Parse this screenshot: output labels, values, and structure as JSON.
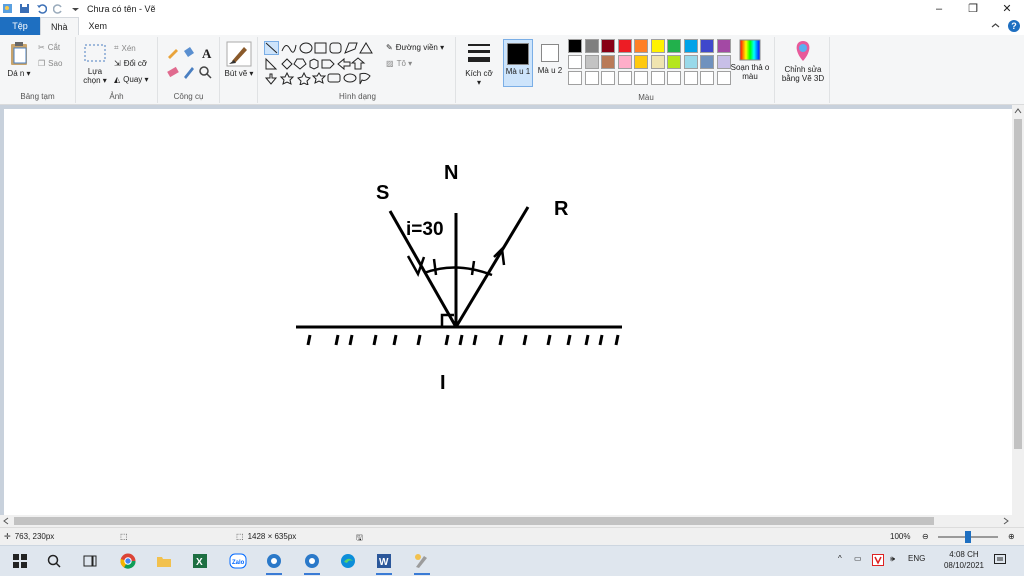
{
  "titlebar": {
    "title": "Chưa có tên - Vẽ",
    "minimize": "–",
    "restore": "❐",
    "close": "✕"
  },
  "tabs": [
    "Tệp",
    "Nhà",
    "Xem"
  ],
  "ribbon": {
    "clipboard": {
      "paste": "Dá n ▾",
      "cut": "Cắt",
      "copy": "Sao",
      "label": "Bảng tạm"
    },
    "image": {
      "select": "Lựa chọn ▾",
      "crop": "Xén",
      "resize": "Đổi cỡ",
      "rotate": "Quay ▾",
      "label": "Ảnh"
    },
    "tools": {
      "label": "Công cụ"
    },
    "brushes": {
      "label": "Bút vẽ ▾"
    },
    "shapes": {
      "outline": "Đường viền ▾",
      "fill": "Tô ▾",
      "label": "Hình dạng"
    },
    "size": {
      "label": "Kích cỡ ▾"
    },
    "color1": "Mà u 1",
    "color2": "Mà u 2",
    "colors_label": "Màu",
    "edit_colors": "Soạn thả o màu",
    "paint3d": "Chỉnh sửa bằng Vẽ 3D",
    "palette_row1": [
      "#000000",
      "#7f7f7f",
      "#880015",
      "#ed1c24",
      "#ff7f27",
      "#fff200",
      "#22b14c",
      "#00a2e8",
      "#3f48cc",
      "#a349a4"
    ],
    "palette_row2": [
      "#ffffff",
      "#c3c3c3",
      "#b97a57",
      "#ffaec9",
      "#ffc90e",
      "#efe4b0",
      "#b5e61d",
      "#99d9ea",
      "#7092be",
      "#c8bfe7"
    ]
  },
  "drawing": {
    "label_N": "N",
    "label_S": "S",
    "label_R": "R",
    "label_I": "I",
    "angle_label": "i=30"
  },
  "status": {
    "cursor": "763, 230px",
    "selection": "",
    "canvas_size": "1428 × 635px",
    "zoom": "100%"
  },
  "taskbar": {
    "language": "ENG",
    "time": "4:08 CH",
    "date": "08/10/2021"
  }
}
